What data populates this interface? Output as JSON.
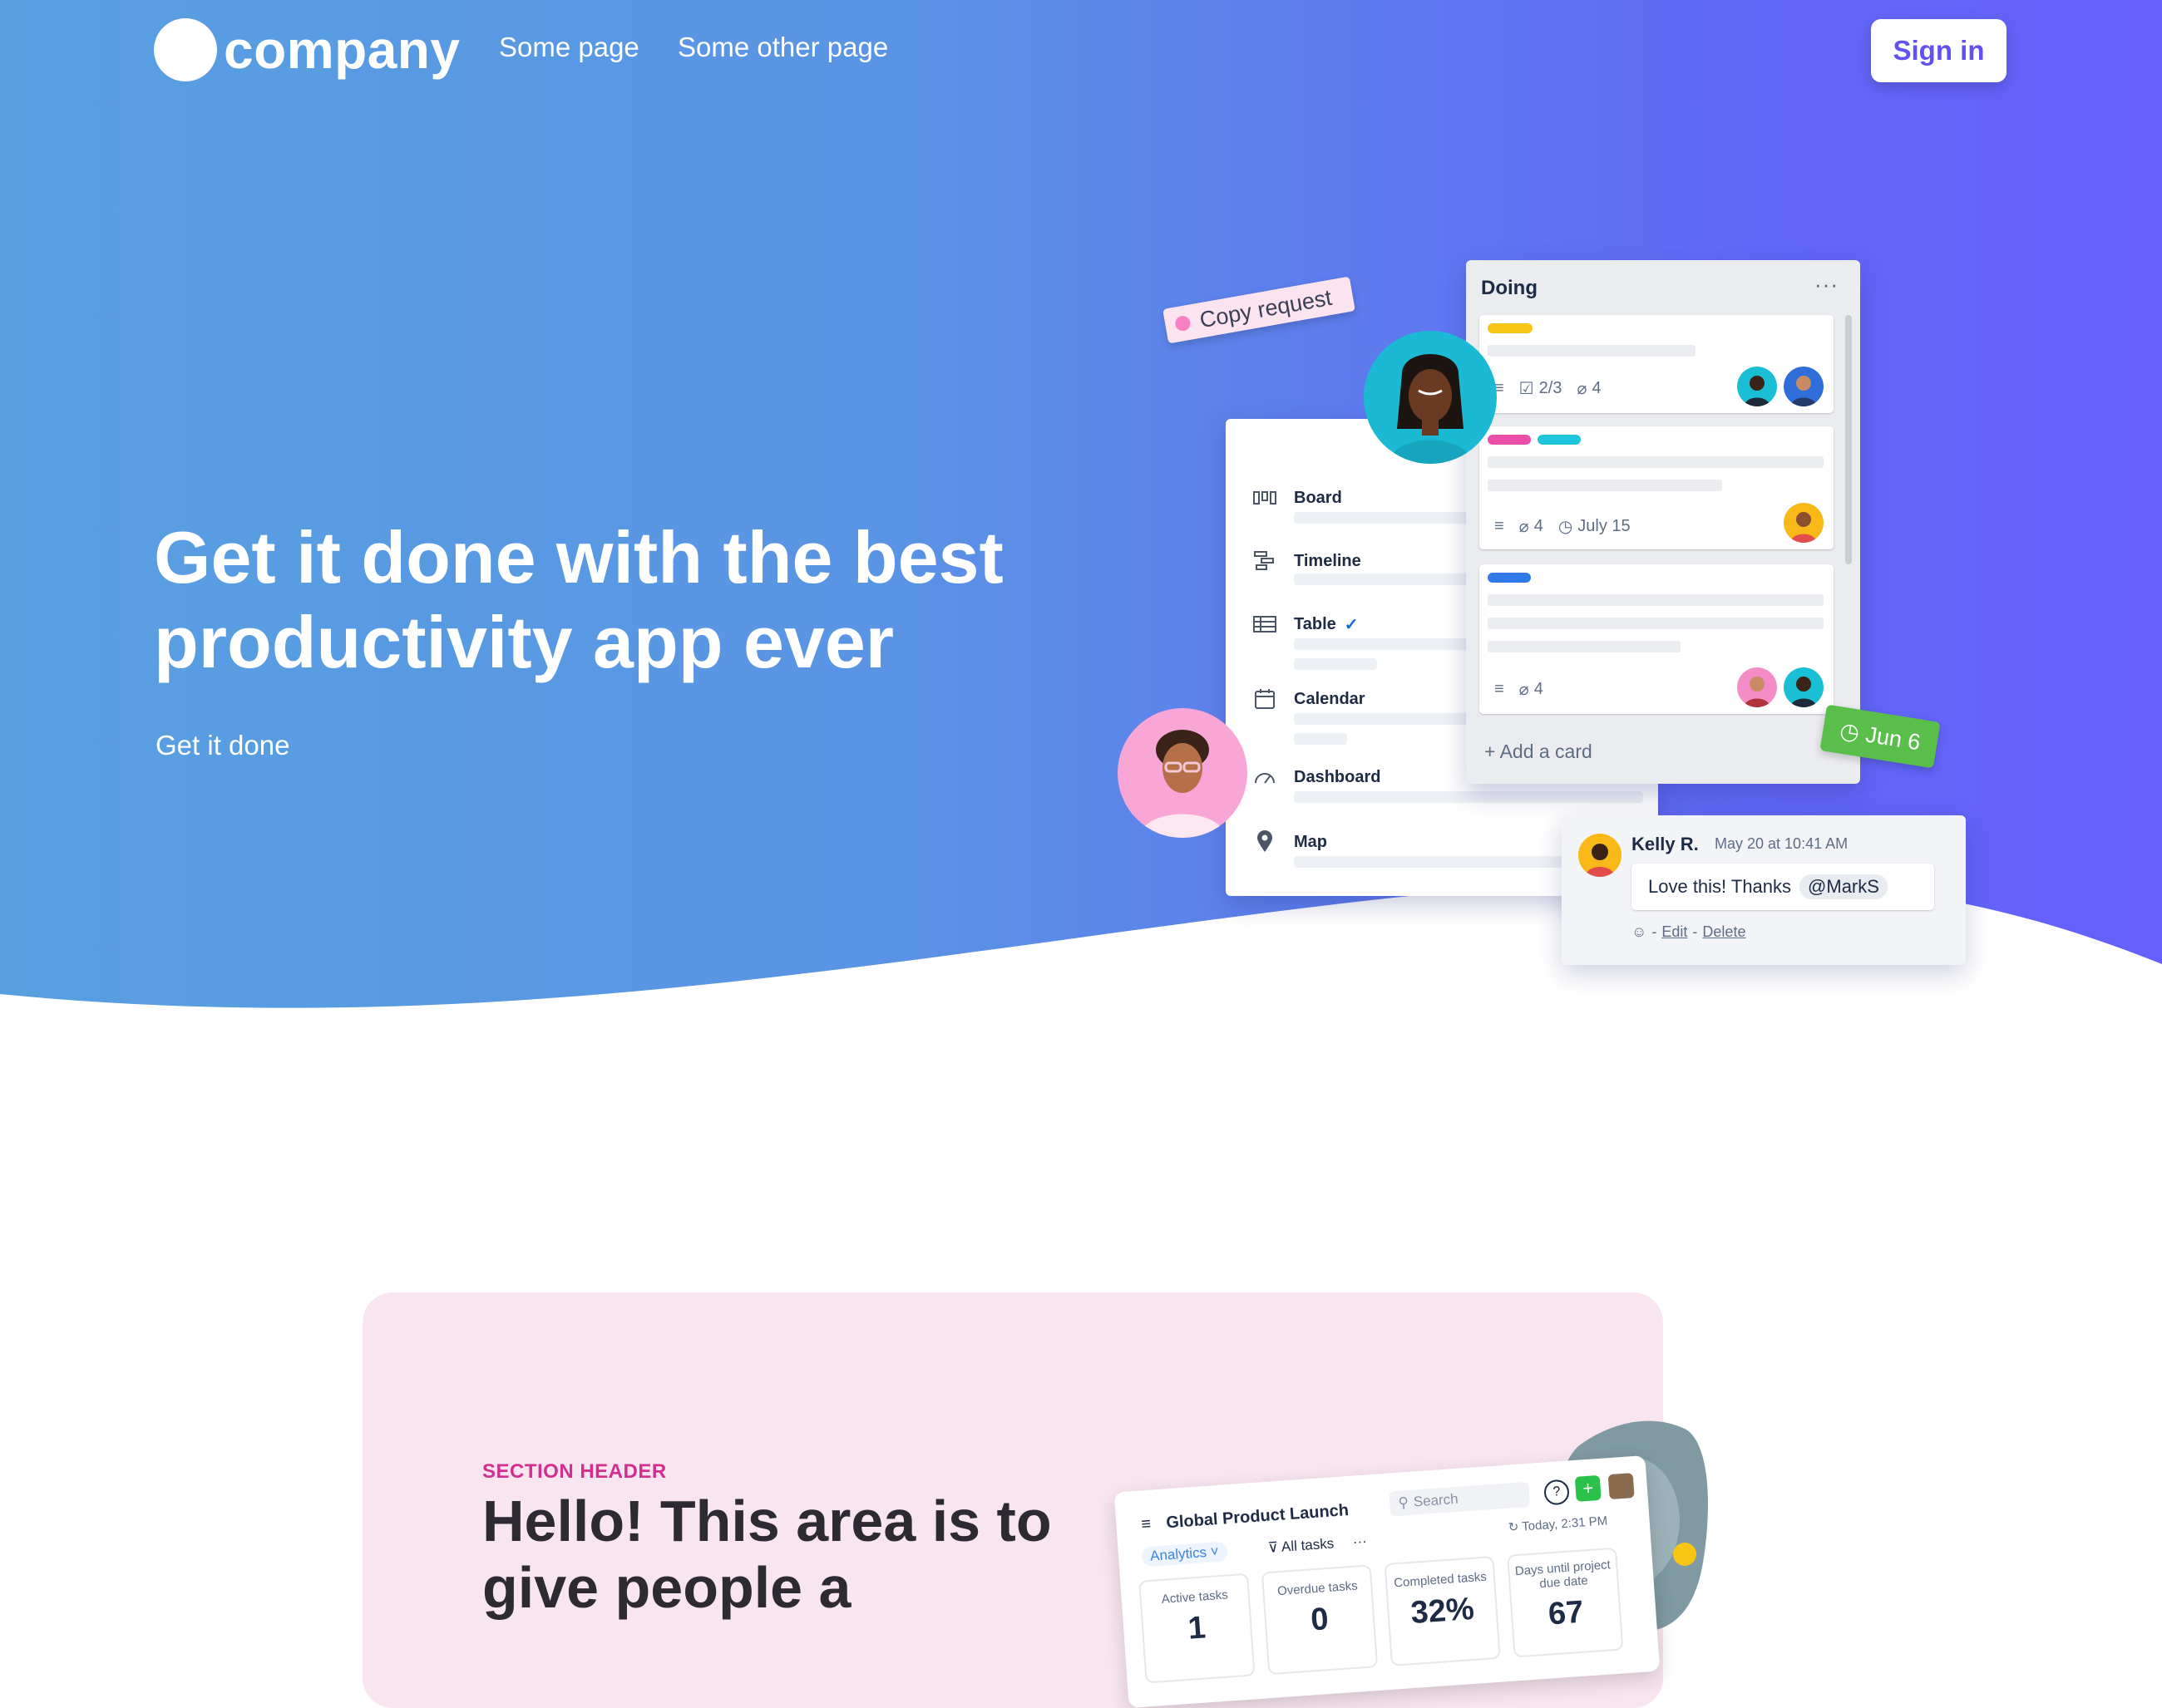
{
  "nav": {
    "brand": "company",
    "links": [
      "Some page",
      "Some other page"
    ],
    "signin_label": "Sign in"
  },
  "hero": {
    "title": "Get it done with the best productivity app ever",
    "subtitle": "Get it done"
  },
  "illustration": {
    "copy_tag": "Copy request",
    "date_tag": "Jun 6",
    "sidebar": {
      "items": [
        {
          "label": "Board",
          "icon": "board-icon"
        },
        {
          "label": "Timeline",
          "icon": "timeline-icon"
        },
        {
          "label": "Table",
          "icon": "table-icon"
        },
        {
          "label": "Calendar",
          "icon": "calendar-icon"
        },
        {
          "label": "Dashboard",
          "icon": "dashboard-icon"
        },
        {
          "label": "Map",
          "icon": "map-pin-icon"
        }
      ]
    },
    "list": {
      "title": "Doing",
      "more": "···",
      "cards": [
        {
          "checklist": "2/3",
          "attachments": "4"
        },
        {
          "attachments": "4",
          "due": "July 15"
        },
        {
          "attachments": "4"
        }
      ],
      "add_card": "Add a card"
    },
    "comment": {
      "author": "Kelly R.",
      "time": "May 20 at 10:41 AM",
      "text": "Love this! Thanks",
      "mention": "@MarkS",
      "actions": [
        "Edit",
        "Delete"
      ]
    }
  },
  "section": {
    "header": "SECTION HEADER",
    "title": "Hello! This area is to give people a",
    "dashboard": {
      "title": "Global Product Launch",
      "search_placeholder": "Search",
      "analytics": "Analytics",
      "all_tasks": "All tasks",
      "today": "Today, 2:31 PM",
      "stats": [
        {
          "label": "Active tasks",
          "value": "1"
        },
        {
          "label": "Overdue tasks",
          "value": "0"
        },
        {
          "label": "Completed tasks",
          "value": "32%"
        },
        {
          "label": "Days until project due date",
          "value": "67"
        }
      ]
    }
  },
  "colors": {
    "hero_gradient_start": "#57a0e0",
    "hero_gradient_end": "#6560fb",
    "accent_purple": "#6251f0",
    "section_bg": "#f8e5f0",
    "section_header": "#d22f8e"
  }
}
